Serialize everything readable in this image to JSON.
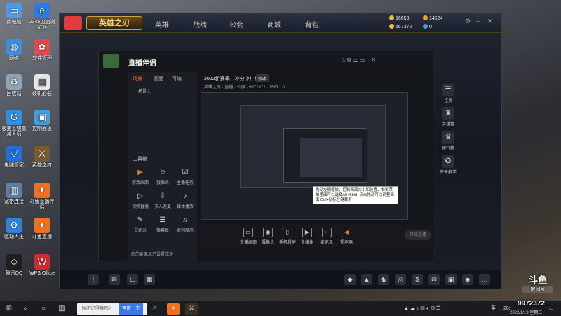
{
  "desktop": {
    "icons": [
      {
        "label": "此电脑",
        "icon": "computer-icon",
        "color": "#4a9be8"
      },
      {
        "label": "2345加速浏览器",
        "icon": "browser-icon",
        "color": "#2b7be2"
      },
      {
        "label": "网络",
        "icon": "network-icon",
        "color": "#3c8ee0"
      },
      {
        "label": "软件管理",
        "icon": "software-manager-icon",
        "color": "#e14b4b"
      },
      {
        "label": "回收站",
        "icon": "recycle-bin-icon",
        "color": "#8fa3b8"
      },
      {
        "label": "装机必装",
        "icon": "folder-icon",
        "color": "#e7e7e7"
      },
      {
        "label": "极速系统重装大师",
        "icon": "system-reinstall-icon",
        "color": "#2f8fe6"
      },
      {
        "label": "控制面板",
        "icon": "control-panel-icon",
        "color": "#3f9de0"
      },
      {
        "label": "电脑管家",
        "icon": "pc-manager-icon",
        "color": "#1e6fe0"
      },
      {
        "label": "英雄之刃",
        "icon": "game-icon",
        "color": "#7a5a2a"
      },
      {
        "label": "宽带连接",
        "icon": "broadband-icon",
        "color": "#5a7fa8"
      },
      {
        "label": "斗鱼直播伴侣",
        "icon": "douyu-companion-icon",
        "color": "#f07020"
      },
      {
        "label": "驱动人生",
        "icon": "driver-icon",
        "color": "#2e83de"
      },
      {
        "label": "斗鱼直播",
        "icon": "douyu-icon",
        "color": "#f07020"
      },
      {
        "label": "腾讯QQ",
        "icon": "qq-icon",
        "color": "#202020"
      },
      {
        "label": "WPS Office",
        "icon": "wps-icon",
        "color": "#d8262f"
      }
    ]
  },
  "game": {
    "logo": "英雄之刃",
    "nav": [
      "英雄",
      "战绩",
      "公会",
      "商城",
      "背包"
    ],
    "resources": [
      {
        "value": "16653",
        "color": "#f0c040"
      },
      {
        "value": "14524",
        "color": "#f0a030"
      },
      {
        "value": "167372",
        "color": "#f0c040"
      },
      {
        "value": "0",
        "color": "#4a9be8"
      }
    ],
    "side": [
      "任务",
      "天梯赛",
      "排行榜",
      "萨卡教学"
    ]
  },
  "streamer": {
    "app_name": "直播伴侣",
    "tabs": [
      "场景",
      "画面",
      "可编"
    ],
    "title": "2022新赛季，冲分中！！",
    "edit": "修改",
    "tags": [
      "英雄之刃",
      "直播 · 公屏",
      "9972372",
      "1587",
      "0"
    ],
    "scene": "场景 1",
    "tools_label": "工具箱",
    "tools": [
      "游戏画面",
      "摄像头",
      "主播任务",
      "视频直播",
      "多人连麦",
      "媒体播放",
      "自定义",
      "弹幕板",
      "歌词展示"
    ],
    "notice": "您的麦克风已设置成功",
    "tooltip": "拖动左侧缩放，控制画面大小和位置。右键菜单里面可以选择Alt+Shift+点击拖动可以调整画面 Ctrl+鼠标左键裁剪",
    "controls": [
      "直播画面",
      "摄像头",
      "手机投屏",
      "多媒体",
      "麦克风",
      "扬声器"
    ],
    "start_button": "开始直播"
  },
  "watermark": {
    "brand": "斗鱼",
    "sub": "房间号",
    "room": "9972372"
  },
  "taskbar": {
    "search_placeholder": "你还记得我吗?",
    "search_button": "百度一下",
    "time": "20:",
    "date": "2022/1/19 星期三",
    "lang": "英"
  }
}
